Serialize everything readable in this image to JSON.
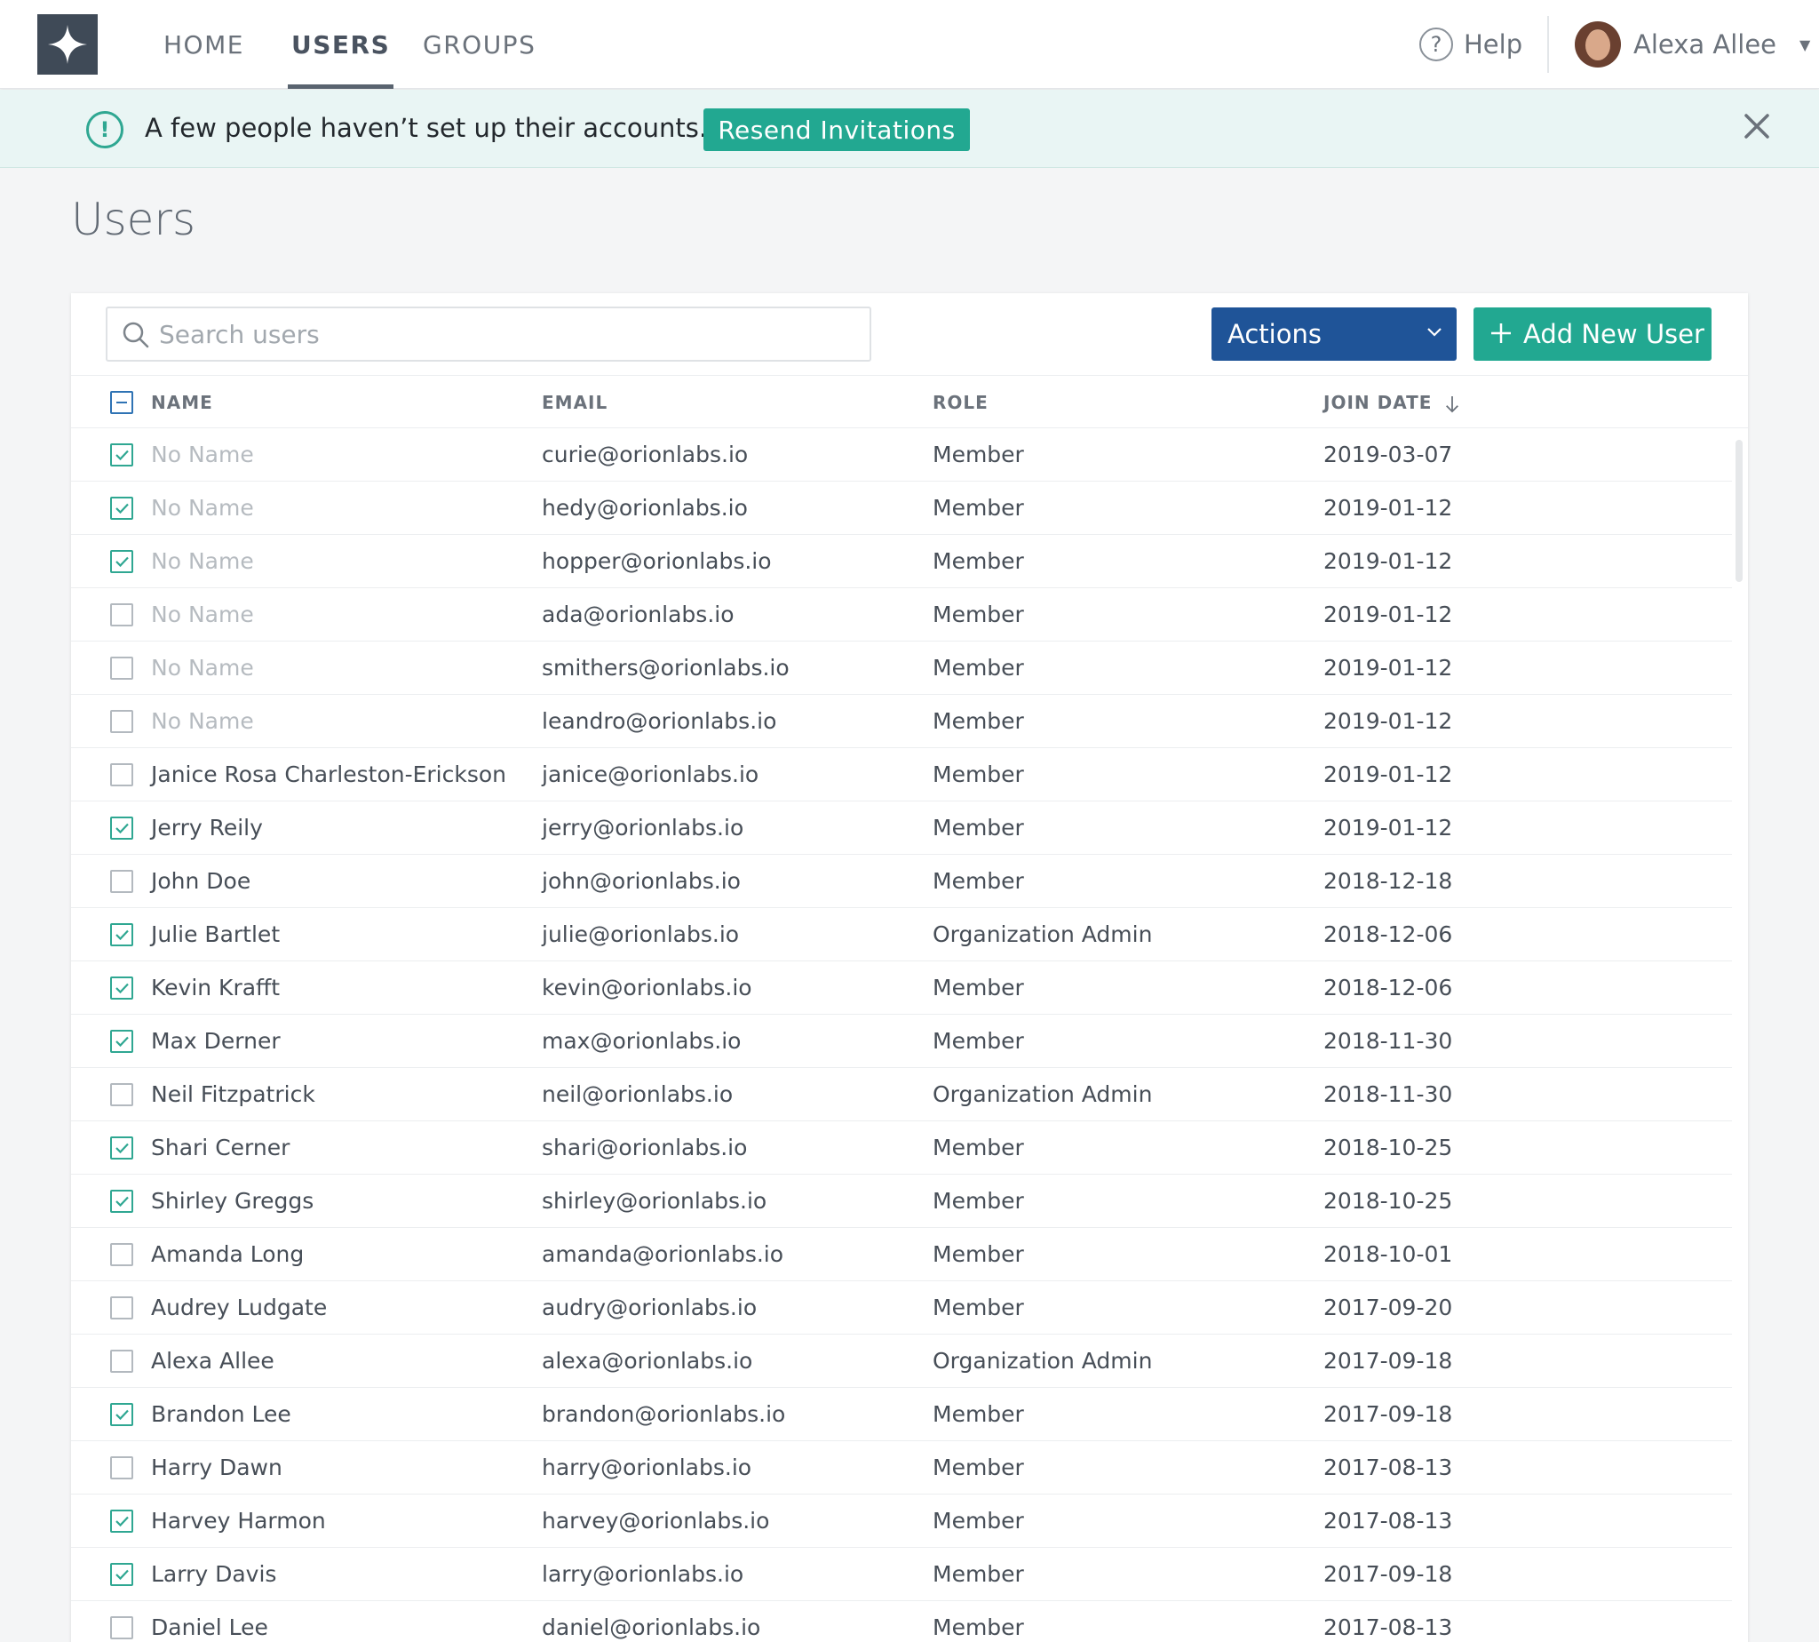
{
  "nav": {
    "tabs": [
      {
        "label": "HOME",
        "active": false
      },
      {
        "label": "USERS",
        "active": true
      },
      {
        "label": "GROUPS",
        "active": false
      }
    ],
    "help_label": "Help",
    "user_name": "Alexa Allee"
  },
  "banner": {
    "message": "A few people haven’t set up their accounts.",
    "button_label": "Resend Invitations"
  },
  "page": {
    "title": "Users"
  },
  "toolbar": {
    "search_placeholder": "Search users",
    "actions_label": "Actions",
    "add_user_label": "Add New User"
  },
  "table": {
    "headers": {
      "name": "NAME",
      "email": "EMAIL",
      "role": "ROLE",
      "join_date": "JOIN DATE"
    },
    "rows": [
      {
        "name": "No Name",
        "email": "curie@orionlabs.io",
        "role": "Member",
        "join_date": "2019-03-07",
        "checked": true,
        "no_name": true
      },
      {
        "name": "No Name",
        "email": "hedy@orionlabs.io",
        "role": "Member",
        "join_date": "2019-01-12",
        "checked": true,
        "no_name": true
      },
      {
        "name": "No Name",
        "email": "hopper@orionlabs.io",
        "role": "Member",
        "join_date": "2019-01-12",
        "checked": true,
        "no_name": true
      },
      {
        "name": "No Name",
        "email": "ada@orionlabs.io",
        "role": "Member",
        "join_date": "2019-01-12",
        "checked": false,
        "no_name": true
      },
      {
        "name": "No Name",
        "email": "smithers@orionlabs.io",
        "role": "Member",
        "join_date": "2019-01-12",
        "checked": false,
        "no_name": true
      },
      {
        "name": "No Name",
        "email": "leandro@orionlabs.io",
        "role": "Member",
        "join_date": "2019-01-12",
        "checked": false,
        "no_name": true
      },
      {
        "name": "Janice Rosa Charleston-Erickson",
        "email": "janice@orionlabs.io",
        "role": "Member",
        "join_date": "2019-01-12",
        "checked": false,
        "no_name": false
      },
      {
        "name": "Jerry Reily",
        "email": "jerry@orionlabs.io",
        "role": "Member",
        "join_date": "2019-01-12",
        "checked": true,
        "no_name": false
      },
      {
        "name": "John Doe",
        "email": "john@orionlabs.io",
        "role": "Member",
        "join_date": "2018-12-18",
        "checked": false,
        "no_name": false
      },
      {
        "name": "Julie Bartlet",
        "email": "julie@orionlabs.io",
        "role": "Organization Admin",
        "join_date": "2018-12-06",
        "checked": true,
        "no_name": false
      },
      {
        "name": "Kevin Krafft",
        "email": "kevin@orionlabs.io",
        "role": "Member",
        "join_date": "2018-12-06",
        "checked": true,
        "no_name": false
      },
      {
        "name": "Max Derner",
        "email": "max@orionlabs.io",
        "role": "Member",
        "join_date": "2018-11-30",
        "checked": true,
        "no_name": false
      },
      {
        "name": "Neil Fitzpatrick",
        "email": "neil@orionlabs.io",
        "role": "Organization Admin",
        "join_date": "2018-11-30",
        "checked": false,
        "no_name": false
      },
      {
        "name": "Shari Cerner",
        "email": "shari@orionlabs.io",
        "role": "Member",
        "join_date": "2018-10-25",
        "checked": true,
        "no_name": false
      },
      {
        "name": "Shirley Greggs",
        "email": "shirley@orionlabs.io",
        "role": "Member",
        "join_date": "2018-10-25",
        "checked": true,
        "no_name": false
      },
      {
        "name": "Amanda Long",
        "email": "amanda@orionlabs.io",
        "role": "Member",
        "join_date": "2018-10-01",
        "checked": false,
        "no_name": false
      },
      {
        "name": "Audrey Ludgate",
        "email": "audry@orionlabs.io",
        "role": "Member",
        "join_date": "2017-09-20",
        "checked": false,
        "no_name": false
      },
      {
        "name": "Alexa Allee",
        "email": "alexa@orionlabs.io",
        "role": "Organization Admin",
        "join_date": "2017-09-18",
        "checked": false,
        "no_name": false
      },
      {
        "name": "Brandon Lee",
        "email": "brandon@orionlabs.io",
        "role": "Member",
        "join_date": "2017-09-18",
        "checked": true,
        "no_name": false
      },
      {
        "name": "Harry Dawn",
        "email": "harry@orionlabs.io",
        "role": "Member",
        "join_date": "2017-08-13",
        "checked": false,
        "no_name": false
      },
      {
        "name": "Harvey Harmon",
        "email": "harvey@orionlabs.io",
        "role": "Member",
        "join_date": "2017-08-13",
        "checked": true,
        "no_name": false
      },
      {
        "name": "Larry Davis",
        "email": "larry@orionlabs.io",
        "role": "Member",
        "join_date": "2017-09-18",
        "checked": true,
        "no_name": false
      },
      {
        "name": "Daniel Lee",
        "email": "daniel@orionlabs.io",
        "role": "Member",
        "join_date": "2017-08-13",
        "checked": false,
        "no_name": false
      }
    ]
  },
  "colors": {
    "accent_teal": "#22a891",
    "actions_blue": "#1f5498",
    "logo_bg": "#3f4a57",
    "banner_bg": "#e9f5f4"
  }
}
